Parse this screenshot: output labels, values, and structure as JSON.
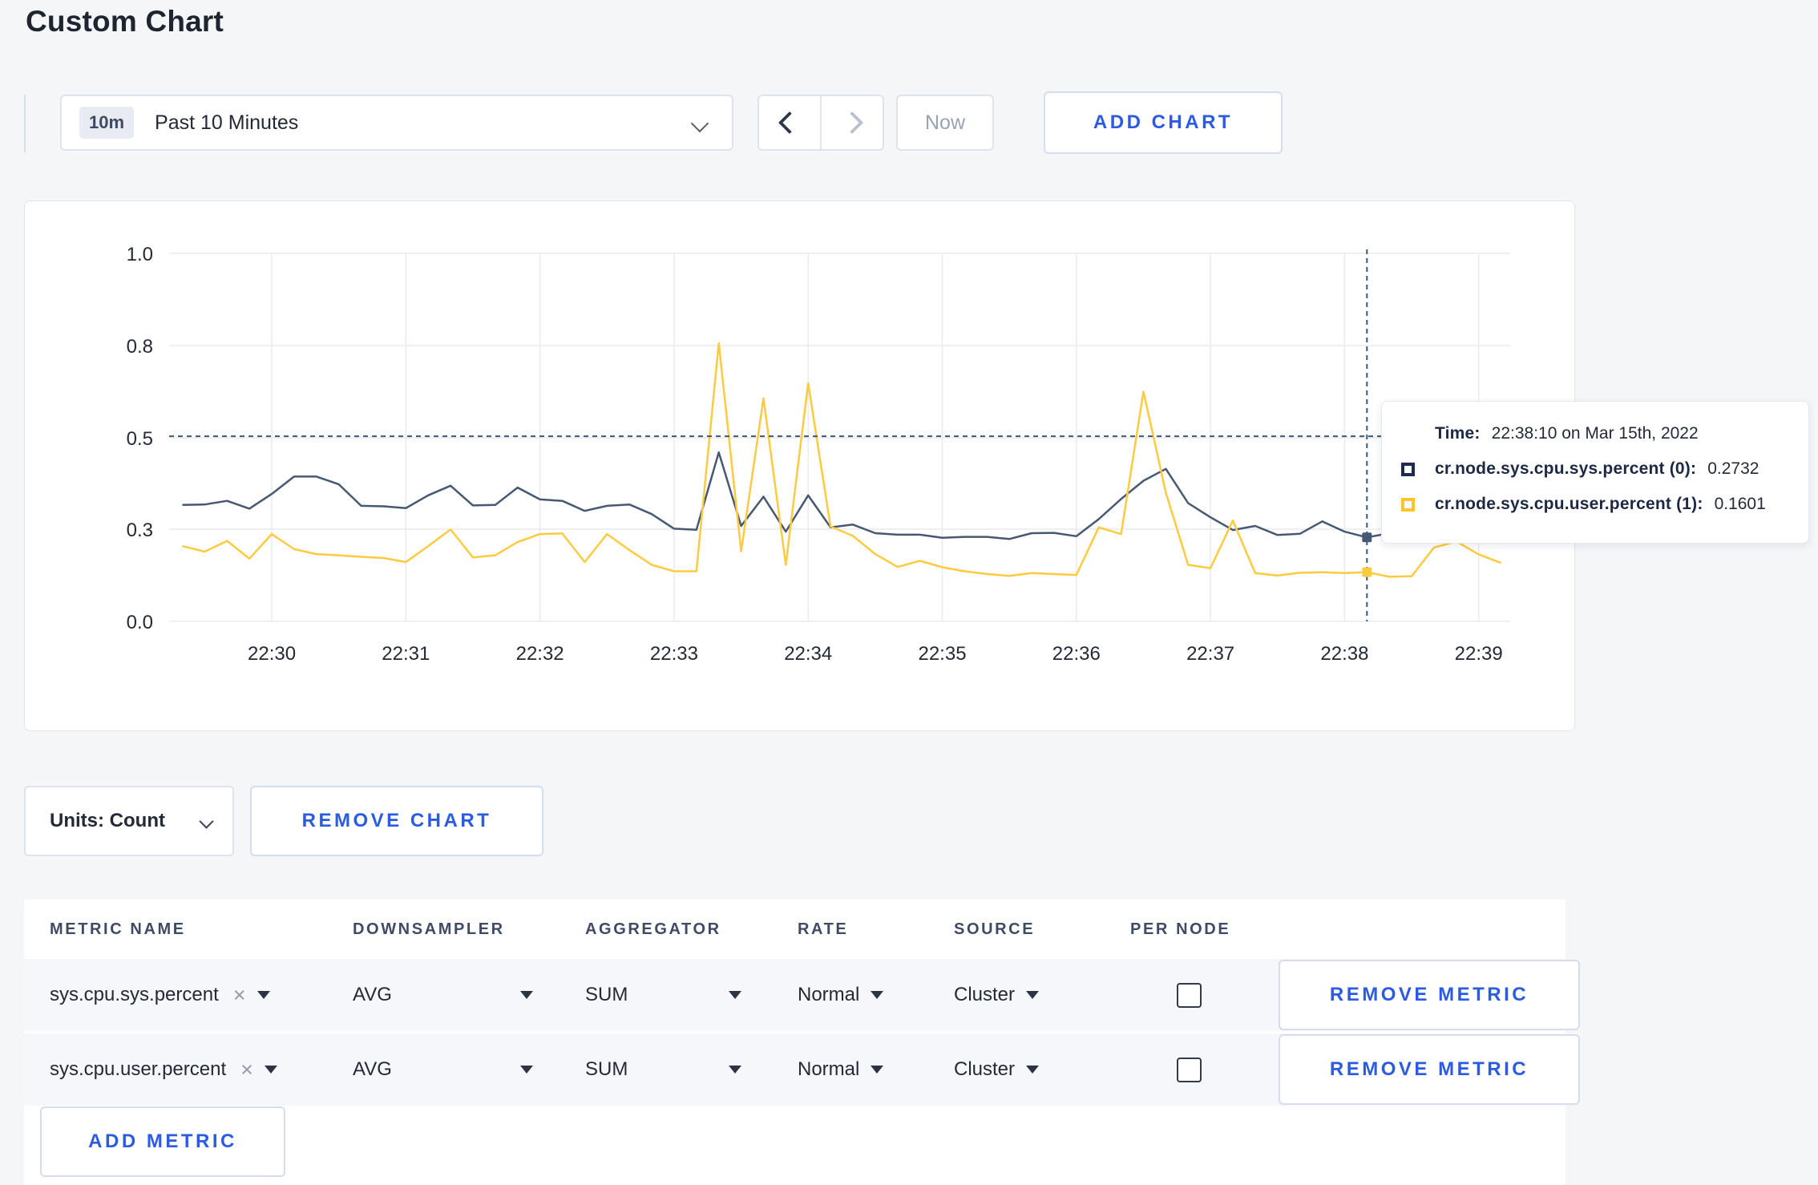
{
  "page_title": "Custom Chart",
  "toolbar": {
    "time_badge": "10m",
    "time_range_label": "Past 10 Minutes",
    "now_label": "Now",
    "add_chart_label": "ADD CHART"
  },
  "colors": {
    "accent_blue": "#2a5be2",
    "grid": "#ebebee",
    "crosshair": "#3b5878",
    "axis_text": "#242a35",
    "series_sys": "#475872",
    "series_user": "#fdca40"
  },
  "chart_data": {
    "type": "line",
    "title": "",
    "xlabel": "",
    "ylabel": "",
    "grid": true,
    "legend_position": "tooltip-only",
    "y_tick_values": [
      0.0,
      0.3,
      0.5,
      0.8,
      1.0
    ],
    "y_tick_labels": [
      "0.0",
      "0.3",
      "0.5",
      "0.8",
      "1.0"
    ],
    "x_tick_labels": [
      "22:30",
      "22:31",
      "22:32",
      "22:33",
      "22:34",
      "22:35",
      "22:36",
      "22:37",
      "22:38",
      "22:39"
    ],
    "x": [
      "22:29:20",
      "22:29:30",
      "22:29:40",
      "22:29:50",
      "22:30:00",
      "22:30:10",
      "22:30:20",
      "22:30:30",
      "22:30:40",
      "22:30:50",
      "22:31:00",
      "22:31:10",
      "22:31:20",
      "22:31:30",
      "22:31:40",
      "22:31:50",
      "22:32:00",
      "22:32:10",
      "22:32:20",
      "22:32:30",
      "22:32:40",
      "22:32:50",
      "22:33:00",
      "22:33:10",
      "22:33:20",
      "22:33:30",
      "22:33:40",
      "22:33:50",
      "22:34:00",
      "22:34:10",
      "22:34:20",
      "22:34:30",
      "22:34:40",
      "22:34:50",
      "22:35:00",
      "22:35:10",
      "22:35:20",
      "22:35:30",
      "22:35:40",
      "22:35:50",
      "22:36:00",
      "22:36:10",
      "22:36:20",
      "22:36:30",
      "22:36:40",
      "22:36:50",
      "22:37:00",
      "22:37:10",
      "22:37:20",
      "22:37:30",
      "22:37:40",
      "22:37:50",
      "22:38:00",
      "22:38:10",
      "22:38:20",
      "22:38:30",
      "22:38:40",
      "22:38:50",
      "22:39:00",
      "22:39:10"
    ],
    "series": [
      {
        "name": "cr.node.sys.cpu.sys.percent (0)",
        "color": "#475872",
        "values": [
          0.353,
          0.354,
          0.362,
          0.345,
          0.377,
          0.415,
          0.415,
          0.398,
          0.351,
          0.35,
          0.346,
          0.374,
          0.395,
          0.352,
          0.353,
          0.391,
          0.365,
          0.362,
          0.34,
          0.351,
          0.354,
          0.333,
          0.301,
          0.298,
          0.468,
          0.307,
          0.371,
          0.292,
          0.374,
          0.304,
          0.31,
          0.287,
          0.282,
          0.282,
          0.272,
          0.275,
          0.275,
          0.268,
          0.287,
          0.288,
          0.277,
          0.322,
          0.366,
          0.406,
          0.432,
          0.357,
          0.326,
          0.297,
          0.307,
          0.281,
          0.285,
          0.317,
          0.292,
          0.2732,
          0.287,
          0.29,
          0.3,
          0.295,
          0.3,
          0.295
        ]
      },
      {
        "name": "cr.node.sys.cpu.user.percent (1)",
        "color": "#fdca40",
        "values": [
          0.245,
          0.227,
          0.262,
          0.204,
          0.284,
          0.235,
          0.219,
          0.215,
          0.21,
          0.206,
          0.193,
          0.245,
          0.299,
          0.208,
          0.215,
          0.258,
          0.284,
          0.286,
          0.193,
          0.284,
          0.232,
          0.184,
          0.163,
          0.163,
          0.805,
          0.228,
          0.628,
          0.184,
          0.677,
          0.306,
          0.278,
          0.219,
          0.177,
          0.197,
          0.176,
          0.163,
          0.154,
          0.148,
          0.157,
          0.154,
          0.151,
          0.304,
          0.284,
          0.65,
          0.38,
          0.184,
          0.173,
          0.319,
          0.157,
          0.149,
          0.158,
          0.16,
          0.157,
          0.1601,
          0.145,
          0.147,
          0.24,
          0.26,
          0.218,
          0.19
        ]
      }
    ],
    "crosshair": {
      "time": "22:38:10",
      "hover_value": 0.505
    }
  },
  "tooltip": {
    "time_label": "Time:",
    "time_value": "22:38:10 on Mar 15th, 2022",
    "series": [
      {
        "label": "cr.node.sys.cpu.sys.percent (0):",
        "value": "0.2732",
        "color": "#1c2b4e"
      },
      {
        "label": "cr.node.sys.cpu.user.percent (1):",
        "value": "0.1601",
        "color": "#fcc52c"
      }
    ]
  },
  "units_row": {
    "units_label": "Units: Count",
    "remove_chart_label": "REMOVE CHART"
  },
  "metrics_table": {
    "headers": [
      "METRIC NAME",
      "DOWNSAMPLER",
      "AGGREGATOR",
      "RATE",
      "SOURCE",
      "PER NODE"
    ],
    "icons": {
      "close": "×"
    },
    "rows": [
      {
        "metric": "sys.cpu.sys.percent",
        "downsampler": "AVG",
        "aggregator": "SUM",
        "rate": "Normal",
        "source": "Cluster",
        "per_node": false,
        "remove_label": "REMOVE METRIC"
      },
      {
        "metric": "sys.cpu.user.percent",
        "downsampler": "AVG",
        "aggregator": "SUM",
        "rate": "Normal",
        "source": "Cluster",
        "per_node": false,
        "remove_label": "REMOVE METRIC"
      }
    ],
    "add_metric_label": "ADD METRIC"
  }
}
